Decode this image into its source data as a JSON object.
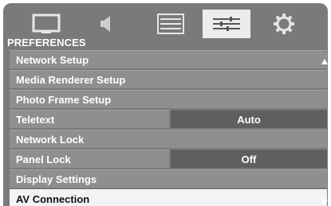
{
  "tabs": [
    {
      "icon": "screen-icon",
      "active": false
    },
    {
      "icon": "speaker-icon",
      "active": false
    },
    {
      "icon": "list-icon",
      "active": false
    },
    {
      "icon": "sliders-icon",
      "active": true
    },
    {
      "icon": "gear-icon",
      "active": false
    }
  ],
  "section_title": "PREFERENCES",
  "menu": [
    {
      "label": "Network Setup"
    },
    {
      "label": "Media Renderer Setup"
    },
    {
      "label": "Photo Frame Setup"
    },
    {
      "label": "Teletext",
      "value": "Auto"
    },
    {
      "label": "Network Lock"
    },
    {
      "label": "Panel Lock",
      "value": "Off"
    },
    {
      "label": "Display Settings"
    },
    {
      "label": "AV Connection",
      "selected": true
    }
  ],
  "colors": {
    "panel_bg": "#7a7a7a",
    "row_bg": "#8f8f8f",
    "value_bg": "#5f5f5f",
    "selected_bg": "#f3f3f3",
    "active_tab_bg": "#ececec"
  }
}
